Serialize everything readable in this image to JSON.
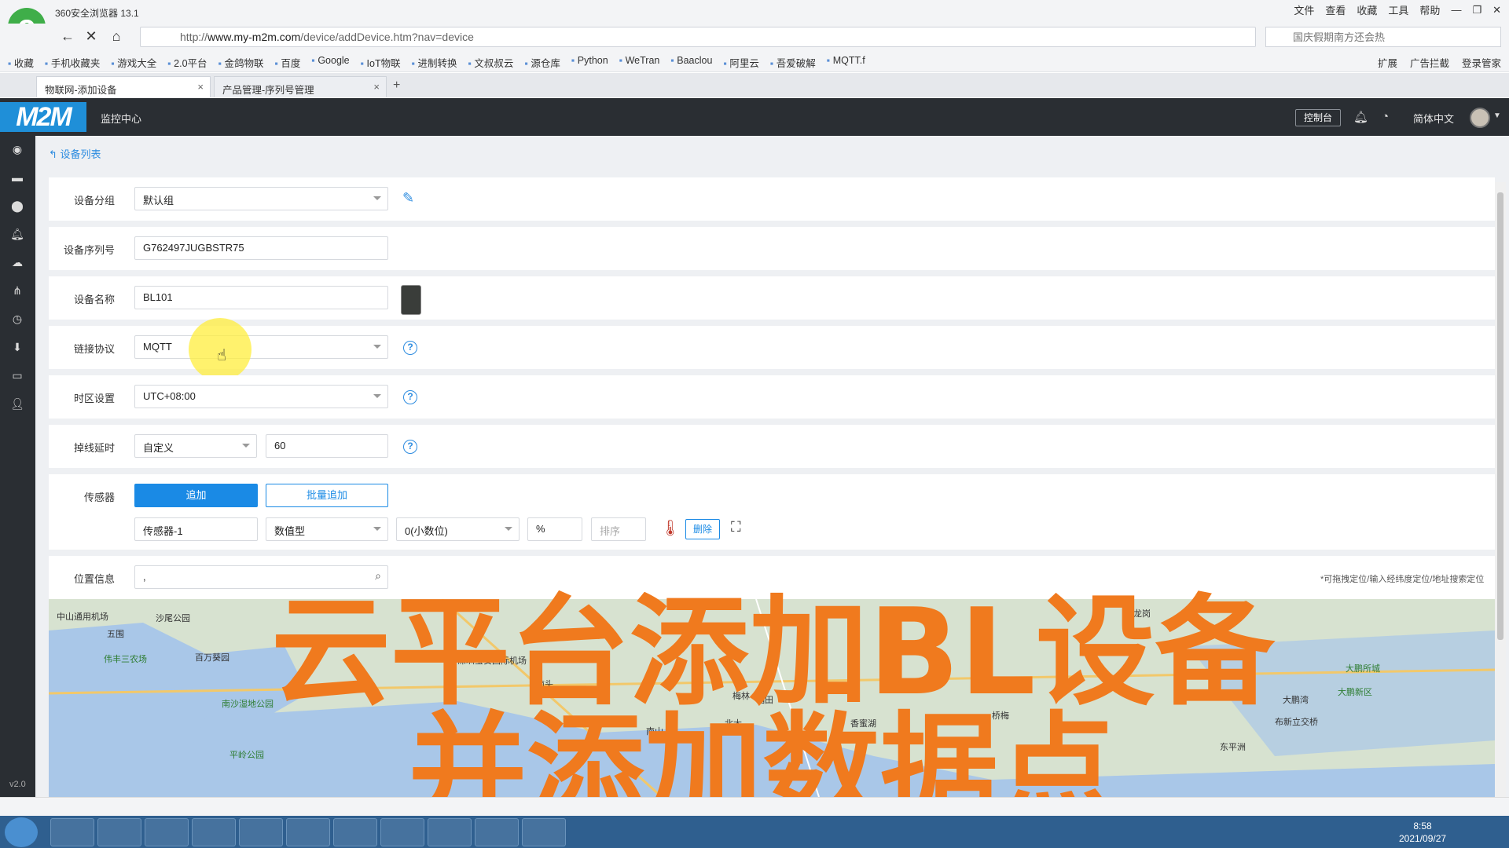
{
  "browser": {
    "brand": "360安全浏览器 13.1",
    "menu": [
      "文件",
      "查看",
      "收藏",
      "工具",
      "帮助"
    ],
    "url_prefix": "http://",
    "url_host": "www.my-m2m.com",
    "url_path": "/device/addDevice.htm?nav=device",
    "search_placeholder": "国庆假期南方还会热",
    "bookmarks": [
      "收藏",
      "手机收藏夹",
      "游戏大全",
      "2.0平台",
      "金鸽物联",
      "百度",
      "Google",
      "IoT物联",
      "进制转换",
      "文叔叔云",
      "源仓库",
      "Python",
      "WeTran",
      "Baaclou",
      "阿里云",
      "吾爱破解",
      "MQTT.f"
    ],
    "bm_right": [
      "扩展",
      "广告拦截",
      "登录管家"
    ],
    "tabs": [
      {
        "label": "物联网-添加设备"
      },
      {
        "label": "产品管理-序列号管理"
      }
    ],
    "new_tab": "+"
  },
  "app": {
    "logo": "M2M",
    "nav_title": "监控中心",
    "console_button": "控制台",
    "language": "简体中文",
    "version": "v2.0"
  },
  "breadcrumb": "设备列表",
  "form": {
    "group_label": "设备分组",
    "group_value": "默认组",
    "serial_label": "设备序列号",
    "serial_value": "G762497JUGBSTR75",
    "name_label": "设备名称",
    "name_value": "BL101",
    "protocol_label": "链接协议",
    "protocol_value": "MQTT",
    "timezone_label": "时区设置",
    "timezone_value": "UTC+08:00",
    "offline_label": "掉线延时",
    "offline_mode": "自定义",
    "offline_value": "60",
    "sensor_label": "传感器",
    "add_button": "追加",
    "batch_add_button": "批量追加",
    "sensor_row": {
      "name": "传感器-1",
      "type": "数值型",
      "decimals": "0(小数位)",
      "unit": "%",
      "order_placeholder": "排序",
      "delete_button": "删除"
    },
    "location_label": "位置信息",
    "location_value": ",",
    "location_hint": "*可拖拽定位/输入经纬度定位/地址搜索定位"
  },
  "map_labels": [
    "中山通用机场",
    "沙尾公园",
    "五围",
    "百万葵园",
    "伟丰三农场",
    "南沙湿地公园",
    "平岭公园",
    "深圳宝安国际机场",
    "福田",
    "北大",
    "梅林",
    "南山",
    "大鹏湾",
    "东平洲",
    "龙岗",
    "大鹏所城",
    "大鹏新区",
    "布新立交桥",
    "桥梅",
    "南头",
    "香蜜湖"
  ],
  "caption": {
    "line1": "云平台添加BL设备",
    "line2": "并添加数据点"
  },
  "taskbar": {
    "time": "8:58",
    "date": "2021/09/27"
  },
  "colors": {
    "accent": "#1a8ae5",
    "header_bg": "#2a2e33",
    "caption": "#f07a1e"
  }
}
